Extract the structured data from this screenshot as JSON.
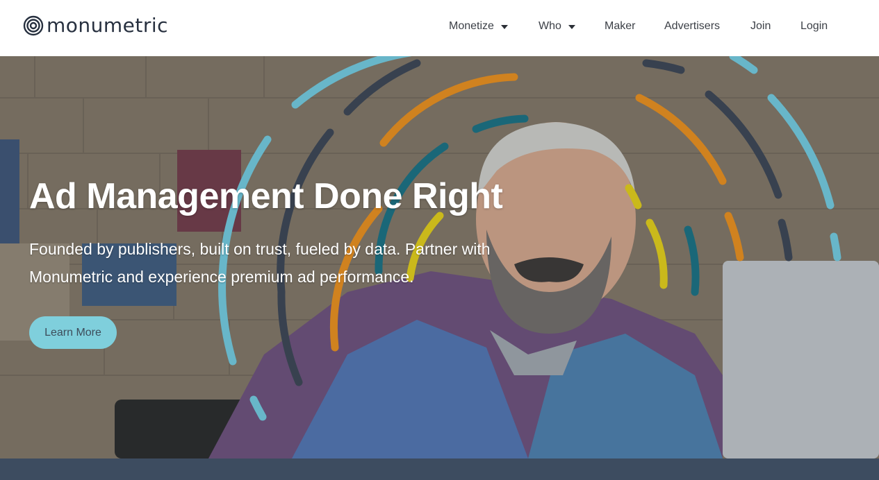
{
  "brand": {
    "name": "monumetric",
    "colors": {
      "dark": "#27303f",
      "accent": "#7fcfdc",
      "footer": "#3d4c60"
    }
  },
  "nav": {
    "items": [
      {
        "label": "Monetize",
        "dropdown": true
      },
      {
        "label": "Who",
        "dropdown": true
      },
      {
        "label": "Maker",
        "dropdown": false
      },
      {
        "label": "Advertisers",
        "dropdown": false
      },
      {
        "label": "Join",
        "dropdown": false
      },
      {
        "label": "Login",
        "dropdown": false
      }
    ]
  },
  "hero": {
    "title": "Ad Management Done Right",
    "subtitle": "Founded by publishers, built on trust, fueled by data. Partner with Monumetric and experience premium ad performance.",
    "cta_label": "Learn More",
    "ring_colors": [
      "#6fc3d6",
      "#3b4452",
      "#e08a1e",
      "#1b6d7e",
      "#d9c61a"
    ]
  }
}
